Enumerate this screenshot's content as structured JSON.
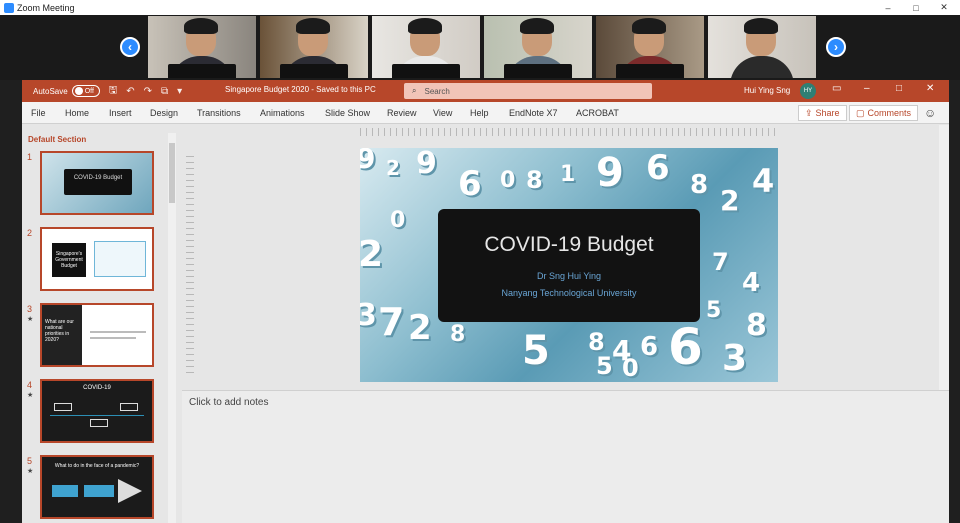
{
  "zoom": {
    "window_title": "Zoom Meeting",
    "minimize": "–",
    "maximize": "□",
    "close": "✕",
    "prev_arrow": "‹",
    "next_arrow": "›",
    "participants_visible": 6
  },
  "ppt": {
    "autosave_label": "AutoSave",
    "autosave_state": "Off",
    "doc_title": "Singapore Budget 2020 - Saved to this PC",
    "search_placeholder": "Search",
    "user_name": "Hui Ying Sng",
    "user_initials": "HY",
    "accent_color": "#b7472a"
  },
  "ribbon": {
    "tabs": [
      "File",
      "Home",
      "Insert",
      "Design",
      "Transitions",
      "Animations",
      "Slide Show",
      "Review",
      "View",
      "Help",
      "EndNote X7",
      "ACROBAT"
    ],
    "share_label": "Share",
    "comments_label": "Comments"
  },
  "thumbnails": {
    "section_label": "Default Section",
    "slides": [
      {
        "number": "1",
        "label": "COVID-19 Budget"
      },
      {
        "number": "2",
        "label": "Singapore's Government Budget"
      },
      {
        "number": "3",
        "label": "What are our national priorities in 2020?"
      },
      {
        "number": "4",
        "label": "COVID-19"
      },
      {
        "number": "5",
        "label": "What to do in the face of a pandemic?"
      }
    ]
  },
  "slide": {
    "title": "COVID-19 Budget",
    "author": "Dr Sng Hui Ying",
    "affiliation": "Nanyang Technological University"
  },
  "notes": {
    "placeholder": "Click to add notes"
  }
}
